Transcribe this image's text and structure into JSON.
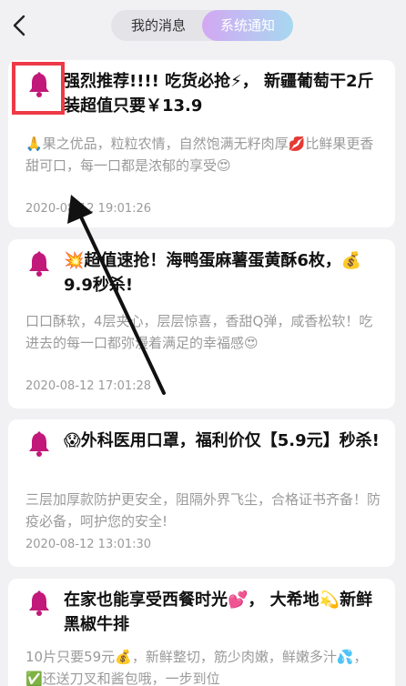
{
  "nav": {
    "back_icon": "chevron-left-icon",
    "tabs": [
      {
        "label": "我的消息",
        "active": false
      },
      {
        "label": "系统通知",
        "active": true
      }
    ],
    "active_gradient": [
      "#d3a8f3",
      "#a7d8f0"
    ]
  },
  "notifications": [
    {
      "icon": "bell-icon",
      "title": "强烈推荐!!!! 吃货必抢⚡， 新疆葡萄干2斤装超值只要￥13.9",
      "body": "🙏果之优品，粒粒农情，自然饱满无籽肉厚💋比鲜果更香甜可口，每一口都是浓郁的享受😍",
      "time": "2020-08-12 19:01:26"
    },
    {
      "icon": "bell-icon",
      "title": "💥超值速抢！海鸭蛋麻薯蛋黄酥6枚，💰9.9秒杀!",
      "body": "口口酥软，4层夹心，层层惊喜，香甜Q弹，咸香松软！吃进去的每一口都弥漫着满足的幸福感😍",
      "time": "2020-08-12 17:01:28"
    },
    {
      "icon": "bell-icon",
      "title": "😱外科医用口罩，福利价仅【5.9元】秒杀!",
      "body": "三层加厚款防护更安全，阻隔外界飞尘，合格证书齐备！防疫必备，呵护您的安全!",
      "time": "2020-08-12 13:01:30"
    },
    {
      "icon": "bell-icon",
      "title": "在家也能享受西餐时光💕， 大希地💫新鲜黑椒牛排",
      "body": "10片只要59元💰，新鲜整切，筋少肉嫩，鲜嫩多汁💦，✅还送刀叉和酱包哦，一步到位",
      "time": ""
    }
  ],
  "colors": {
    "bell": "#c2187a",
    "highlight_box": "#ee3a47",
    "annotation_arrow": "#111111"
  }
}
